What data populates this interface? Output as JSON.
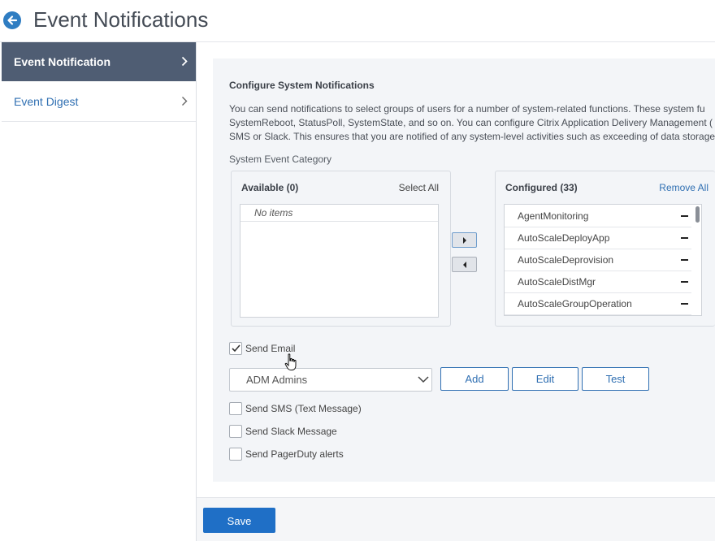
{
  "header": {
    "title": "Event Notifications"
  },
  "sidebar": {
    "items": [
      {
        "label": "Event Notification"
      },
      {
        "label": "Event Digest"
      }
    ]
  },
  "main": {
    "section_title": "Configure System Notifications",
    "description_lines": [
      "You can send notifications to select groups of users for a number of system-related functions. These system fu",
      "SystemReboot, StatusPoll, SystemState, and so on. You can configure Citrix Application Delivery Management (",
      "SMS or Slack. This ensures that you are notified of any system-level activities such as exceeding of data storage"
    ],
    "category_label": "System Event Category",
    "available": {
      "title": "Available (0)",
      "action": "Select All",
      "empty_text": "No items"
    },
    "configured": {
      "title": "Configured (33)",
      "action": "Remove All",
      "items": [
        "AgentMonitoring",
        "AutoScaleDeployApp",
        "AutoScaleDeprovision",
        "AutoScaleDistMgr",
        "AutoScaleGroupOperation"
      ]
    },
    "send_email": {
      "label": "Send Email",
      "checked": true
    },
    "email_profile": {
      "value": "ADM Admins"
    },
    "buttons": {
      "add": "Add",
      "edit": "Edit",
      "test": "Test"
    },
    "send_sms": {
      "label": "Send SMS (Text Message)",
      "checked": false
    },
    "send_slack": {
      "label": "Send Slack Message",
      "checked": false
    },
    "send_pagerduty": {
      "label": "Send PagerDuty alerts",
      "checked": false
    }
  },
  "footer": {
    "save_label": "Save"
  },
  "colors": {
    "accent": "#2f6fb2",
    "sidebar_active": "#4f5d73",
    "save_button": "#1f6fc6",
    "panel_bg": "#f3f5f8"
  }
}
